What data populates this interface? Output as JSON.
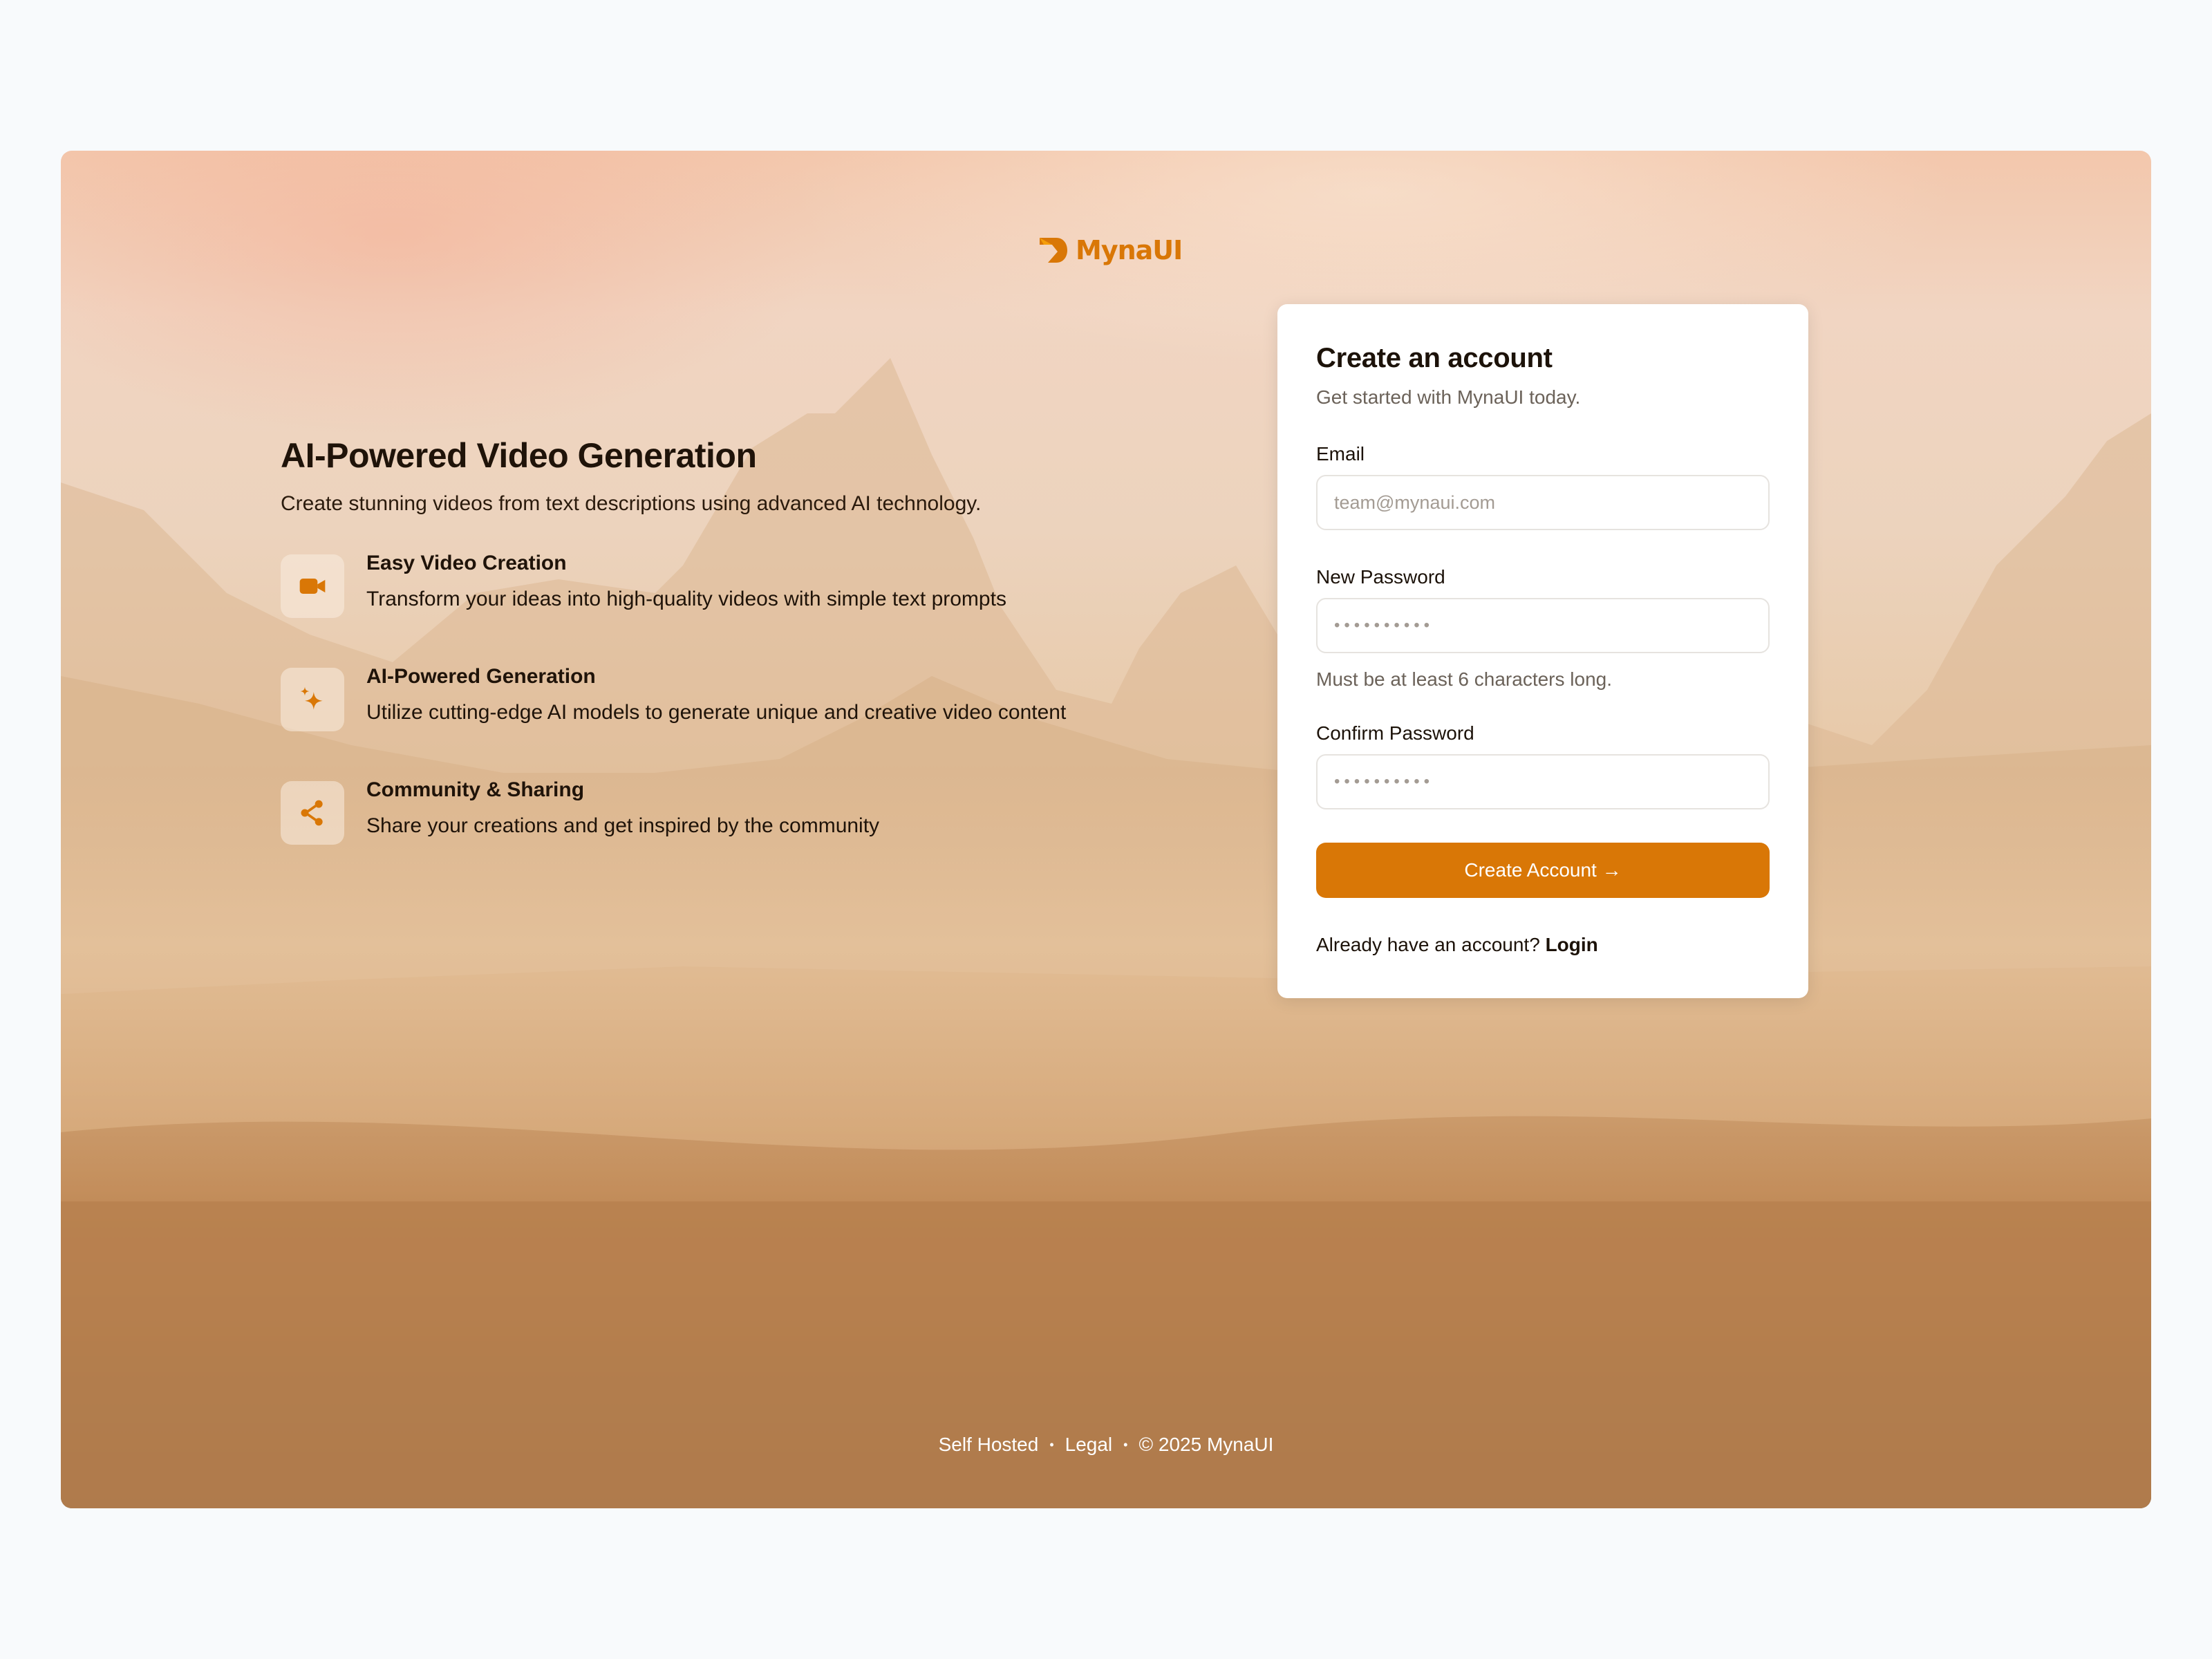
{
  "brand": {
    "name": "MynaUI",
    "color": "#d97706"
  },
  "hero": {
    "title": "AI-Powered Video Generation",
    "subtitle": "Create stunning videos from text descriptions using advanced AI technology."
  },
  "features": [
    {
      "icon": "video-camera-icon",
      "title": "Easy Video Creation",
      "description": "Transform your ideas into high-quality videos with simple text prompts"
    },
    {
      "icon": "sparkles-icon",
      "title": "AI-Powered Generation",
      "description": "Utilize cutting-edge AI models to generate unique and creative video content"
    },
    {
      "icon": "share-icon",
      "title": "Community & Sharing",
      "description": "Share your creations and get inspired by the community"
    }
  ],
  "form": {
    "title": "Create an account",
    "subtitle": "Get started with MynaUI today.",
    "email": {
      "label": "Email",
      "placeholder": "team@mynaui.com",
      "value": ""
    },
    "new_password": {
      "label": "New Password",
      "value": "••••••••••",
      "hint": "Must be at least 6 characters long."
    },
    "confirm_password": {
      "label": "Confirm Password",
      "value": "••••••••••"
    },
    "submit_label": "Create Account →",
    "login_prompt": "Already have an account?",
    "login_link": "Login"
  },
  "footer": {
    "links": [
      "Self Hosted",
      "Legal"
    ],
    "separator": "•",
    "copyright": "© 2025 MynaUI"
  }
}
